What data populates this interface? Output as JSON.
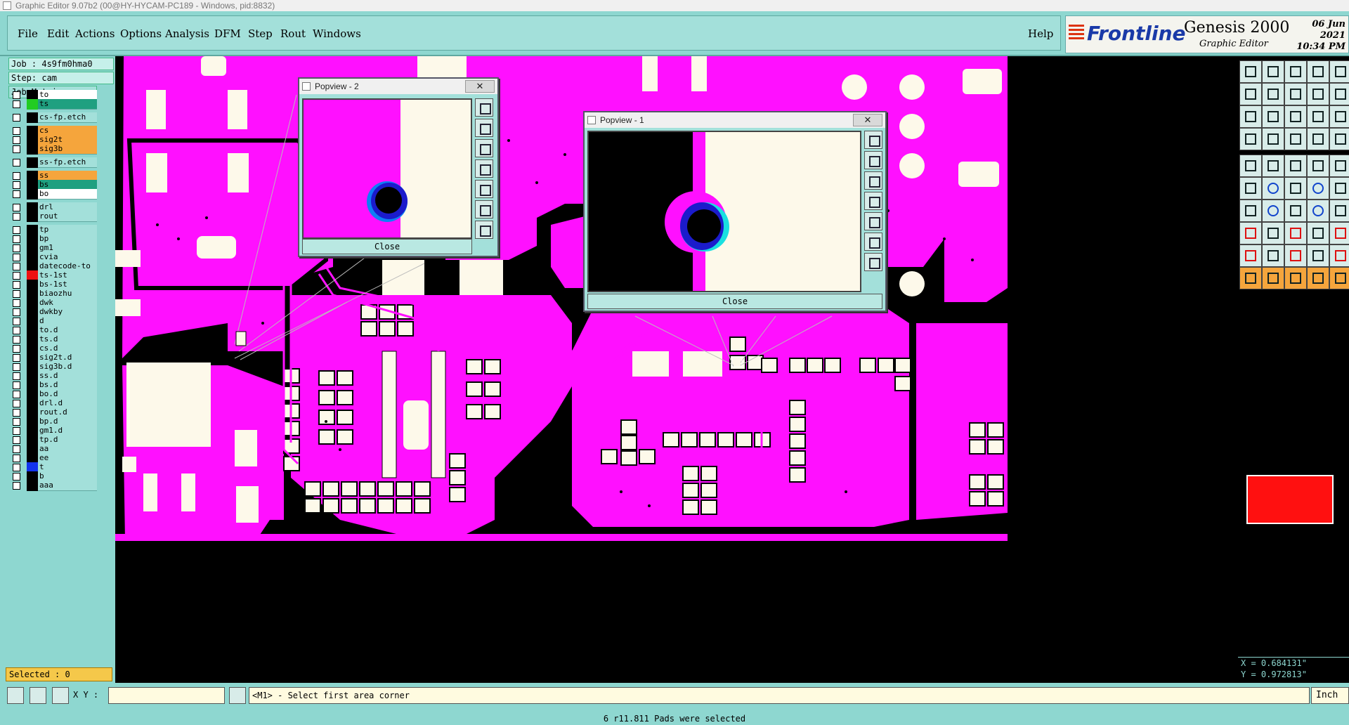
{
  "window": {
    "title": "Graphic Editor 9.07b2 (00@HY-HYCAM-PC189 - Windows, pid:8832)"
  },
  "menu": {
    "file": "File",
    "edit": "Edit",
    "actions": "Actions",
    "options": "Options",
    "analysis": "Analysis",
    "dfm": "DFM",
    "step": "Step",
    "rout": "Rout",
    "windows": "Windows",
    "help": "Help"
  },
  "brand": {
    "logo": "Frontline",
    "product": "Genesis 2000",
    "subtitle": "Graphic Editor",
    "date": "06 Jun 2021",
    "time": "10:34 PM"
  },
  "left": {
    "job": "Job : 4s9fm0hma0",
    "step": "Step: cam",
    "job_matrix": "Job Matrix ...",
    "selected": "Selected : 0"
  },
  "layers": [
    {
      "name": "to",
      "swatch": "#000000",
      "style": "white"
    },
    {
      "name": "ts",
      "swatch": "#22cc22",
      "style": "teal"
    },
    {
      "name": "cs-fp.etch",
      "swatch": "#000000",
      "style": ""
    },
    {
      "name": "cs",
      "swatch": "#000000",
      "style": "sel"
    },
    {
      "name": "sig2t",
      "swatch": "#000000",
      "style": "sel"
    },
    {
      "name": "sig3b",
      "swatch": "#000000",
      "style": "sel"
    },
    {
      "name": "ss-fp.etch",
      "swatch": "#000000",
      "style": ""
    },
    {
      "name": "ss",
      "swatch": "#000000",
      "style": "sel"
    },
    {
      "name": "bs",
      "swatch": "#000000",
      "style": "teal"
    },
    {
      "name": "bo",
      "swatch": "#000000",
      "style": "white"
    },
    {
      "name": "drl",
      "swatch": "#000000",
      "style": ""
    },
    {
      "name": "rout",
      "swatch": "#000000",
      "style": ""
    },
    {
      "name": "tp",
      "swatch": "#000000",
      "style": ""
    },
    {
      "name": "bp",
      "swatch": "#000000",
      "style": ""
    },
    {
      "name": "gm1",
      "swatch": "#000000",
      "style": ""
    },
    {
      "name": "cvia",
      "swatch": "#000000",
      "style": ""
    },
    {
      "name": "datecode-to",
      "swatch": "#000000",
      "style": ""
    },
    {
      "name": "ts-1st",
      "swatch": "#ee1111",
      "style": ""
    },
    {
      "name": "bs-1st",
      "swatch": "#000000",
      "style": ""
    },
    {
      "name": "biaozhu",
      "swatch": "#000000",
      "style": ""
    },
    {
      "name": "dwk",
      "swatch": "#000000",
      "style": ""
    },
    {
      "name": "dwkby",
      "swatch": "#000000",
      "style": ""
    },
    {
      "name": "d",
      "swatch": "#000000",
      "style": ""
    },
    {
      "name": "to.d",
      "swatch": "#000000",
      "style": ""
    },
    {
      "name": "ts.d",
      "swatch": "#000000",
      "style": ""
    },
    {
      "name": "cs.d",
      "swatch": "#000000",
      "style": ""
    },
    {
      "name": "sig2t.d",
      "swatch": "#000000",
      "style": ""
    },
    {
      "name": "sig3b.d",
      "swatch": "#000000",
      "style": ""
    },
    {
      "name": "ss.d",
      "swatch": "#000000",
      "style": ""
    },
    {
      "name": "bs.d",
      "swatch": "#000000",
      "style": ""
    },
    {
      "name": "bo.d",
      "swatch": "#000000",
      "style": ""
    },
    {
      "name": "drl.d",
      "swatch": "#000000",
      "style": ""
    },
    {
      "name": "rout.d",
      "swatch": "#000000",
      "style": ""
    },
    {
      "name": "bp.d",
      "swatch": "#000000",
      "style": ""
    },
    {
      "name": "gm1.d",
      "swatch": "#000000",
      "style": ""
    },
    {
      "name": "tp.d",
      "swatch": "#000000",
      "style": ""
    },
    {
      "name": "aa",
      "swatch": "#000000",
      "style": ""
    },
    {
      "name": "ee",
      "swatch": "#000000",
      "style": ""
    },
    {
      "name": "t",
      "swatch": "#1133ee",
      "style": ""
    },
    {
      "name": "b",
      "swatch": "#000000",
      "style": ""
    },
    {
      "name": "aaa",
      "swatch": "#000000",
      "style": ""
    }
  ],
  "popview2": {
    "title": "Popview - 2",
    "close": "Close"
  },
  "popview1": {
    "title": "Popview - 1",
    "close": "Close"
  },
  "coords": {
    "x": "X = 0.684131\"",
    "y": "Y = 0.972813\""
  },
  "bottom": {
    "xy_label": "X Y :",
    "prompt": "<M1> - Select first area corner",
    "unit": "Inch",
    "status": "6 r11.811 Pads were selected"
  },
  "colors": {
    "board": "#ff10ff",
    "pad": "#fdf9ea",
    "background": "#000000",
    "panel": "#8ed7d0"
  }
}
